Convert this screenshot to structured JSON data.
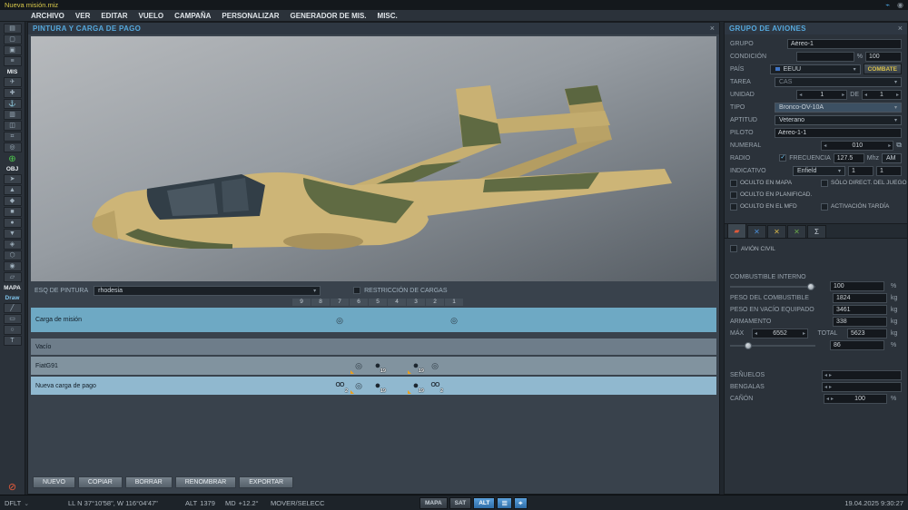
{
  "title_bar": {
    "title": "Nueva misión.miz"
  },
  "menu": {
    "items": [
      "ARCHIVO",
      "VER",
      "EDITAR",
      "VUELO",
      "CAMPAÑA",
      "PERSONALIZAR",
      "GENERADOR DE MIS.",
      "MISC."
    ]
  },
  "sidebar": {
    "items": [
      {
        "type": "icon",
        "name": "new-file",
        "glyph": "▤"
      },
      {
        "type": "icon",
        "name": "open-file",
        "glyph": "▢"
      },
      {
        "type": "icon",
        "name": "save-file",
        "glyph": "▣"
      },
      {
        "type": "icon",
        "name": "briefing",
        "glyph": "≡"
      },
      {
        "type": "label",
        "text": "MIS"
      },
      {
        "type": "icon",
        "name": "airplane-group",
        "glyph": "✈"
      },
      {
        "type": "icon",
        "name": "helicopter-group",
        "glyph": "✚"
      },
      {
        "type": "icon",
        "name": "ship-group",
        "glyph": "⚓"
      },
      {
        "type": "icon",
        "name": "vehicle-group",
        "glyph": "▥"
      },
      {
        "type": "icon",
        "name": "static-object",
        "glyph": "◫"
      },
      {
        "type": "icon",
        "name": "template",
        "glyph": "⌗"
      },
      {
        "type": "icon",
        "name": "trigger-zone",
        "glyph": "◎"
      },
      {
        "type": "icon",
        "name": "add-waypoint",
        "glyph": "⊕",
        "class": "green"
      },
      {
        "type": "label",
        "text": "OBJ"
      },
      {
        "type": "icon",
        "name": "objective-1",
        "glyph": "➤"
      },
      {
        "type": "icon",
        "name": "objective-2",
        "glyph": "▲"
      },
      {
        "type": "icon",
        "name": "objective-3",
        "glyph": "◆"
      },
      {
        "type": "icon",
        "name": "objective-4",
        "glyph": "■"
      },
      {
        "type": "icon",
        "name": "objective-5",
        "glyph": "●"
      },
      {
        "type": "icon",
        "name": "objective-6",
        "glyph": "▼"
      },
      {
        "type": "icon",
        "name": "objective-7",
        "glyph": "◈"
      },
      {
        "type": "icon",
        "name": "objective-8",
        "glyph": "⬡"
      },
      {
        "type": "icon",
        "name": "objective-9",
        "glyph": "◉"
      },
      {
        "type": "icon",
        "name": "objective-10",
        "glyph": "▱"
      },
      {
        "type": "label",
        "text": "MAPA"
      },
      {
        "type": "label",
        "text": "Draw",
        "class": "draw"
      },
      {
        "type": "icon",
        "name": "draw-line",
        "glyph": "╱"
      },
      {
        "type": "icon",
        "name": "draw-rect",
        "glyph": "▭"
      },
      {
        "type": "icon",
        "name": "draw-circle",
        "glyph": "○"
      },
      {
        "type": "icon",
        "name": "draw-text",
        "glyph": "T"
      },
      {
        "type": "icon",
        "name": "delete",
        "glyph": "⊘",
        "class": "red"
      }
    ]
  },
  "payload_panel": {
    "title": "PINTURA Y CARGA DE PAGO",
    "paint_label": "ESQ DE PINTURA",
    "paint_scheme": "rhodesia",
    "restriction_label": "RESTRICCIÓN DE CARGAS",
    "columns": [
      "9",
      "8",
      "7",
      "6",
      "5",
      "4",
      "3",
      "2",
      "1"
    ],
    "rows": [
      {
        "name": "Carga de misión",
        "style": "mission",
        "cells": {
          "7": {
            "kind": "pod",
            "glyph": "◎",
            "count": ""
          },
          "1": {
            "kind": "pod",
            "glyph": "◎",
            "count": ""
          }
        }
      },
      {
        "name": "Vacío",
        "style": "empty",
        "cells": {}
      },
      {
        "name": "FiatG91",
        "style": "normal",
        "cells": {
          "6": {
            "kind": "pod",
            "glyph": "◎",
            "count": "",
            "mark": true
          },
          "5": {
            "kind": "ball",
            "glyph": "●",
            "count": "19"
          },
          "3": {
            "kind": "ball",
            "glyph": "●",
            "count": "19",
            "mark": true
          },
          "2": {
            "kind": "pod",
            "glyph": "◎",
            "count": ""
          }
        }
      },
      {
        "name": "Nueva carga de pago",
        "style": "selected",
        "cells": {
          "7": {
            "kind": "twin",
            "glyph": "ΟΟ",
            "count": "2"
          },
          "6": {
            "kind": "pod",
            "glyph": "◎",
            "count": "",
            "mark": true
          },
          "5": {
            "kind": "ball",
            "glyph": "●",
            "count": "19"
          },
          "3": {
            "kind": "ball",
            "glyph": "●",
            "count": "19",
            "mark": true
          },
          "2": {
            "kind": "twin",
            "glyph": "ΟΟ",
            "count": "2"
          }
        }
      }
    ],
    "buttons": [
      "NUEVO",
      "COPIAR",
      "BORRAR",
      "RENOMBRAR",
      "EXPORTAR"
    ]
  },
  "group_panel": {
    "title": "GRUPO DE AVIONES",
    "fields": {
      "grupo": {
        "label": "GRUPO",
        "value": "Aéreo-1"
      },
      "condicion": {
        "label": "CONDICIÓN",
        "value": "",
        "value2": "100"
      },
      "pais": {
        "label": "PAÍS",
        "value": "EEUU",
        "combat": "COMBATE"
      },
      "tarea": {
        "label": "TAREA",
        "value": "CAS"
      },
      "unidad": {
        "label": "UNIDAD",
        "value": "1",
        "de": "DE",
        "value2": "1"
      },
      "tipo": {
        "label": "TIPO",
        "value": "Bronco-OV-10A"
      },
      "aptitud": {
        "label": "APTITUD",
        "value": "Veterano"
      },
      "piloto": {
        "label": "PILOTO",
        "value": "Aéreo-1-1"
      },
      "numeral": {
        "label": "NUMERAL",
        "value": "010"
      },
      "radio": {
        "label": "RADIO",
        "freq_label": "FRECUENCIA",
        "freq": "127.5",
        "unit": "Mhz",
        "mod": "AM"
      },
      "indicativo": {
        "label": "INDICATIVO",
        "value": "Enfield",
        "num1": "1",
        "num2": "1"
      }
    },
    "checkboxes": {
      "oculto_mapa": "OCULTO EN MAPA",
      "solo_direct": "SÓLO DIRECT. DEL JUEGO",
      "oculto_plan": "OCULTO EN PLANIFICAD.",
      "oculto_mfd": "OCULTO EN EL MFD",
      "activacion": "ACTIVACIÓN TARDÍA"
    },
    "tabs": [
      {
        "name": "tab-paint",
        "glyph": "▰",
        "color": "#e05a3a",
        "selected": true
      },
      {
        "name": "tab-payload",
        "glyph": "✕",
        "color": "#4a8fd8",
        "selected": false
      },
      {
        "name": "tab-flag-yellow",
        "glyph": "✕",
        "color": "#d8b84a",
        "selected": false
      },
      {
        "name": "tab-flag-green",
        "glyph": "✕",
        "color": "#6aa84a",
        "selected": false
      },
      {
        "name": "tab-summary",
        "glyph": "Σ",
        "color": "#c8d0d8",
        "selected": false
      }
    ],
    "avion_civil": "AVIÓN CIVIL",
    "fuel": {
      "internal_label": "COMBUSTIBLE INTERNO",
      "internal_value": "100",
      "fuel_weight_label": "PESO DEL COMBUSTIBLE",
      "fuel_weight": "1824",
      "empty_weight_label": "PESO EN VACÍO EQUIPADO",
      "empty_weight": "3461",
      "armament_label": "ARMAMENTO",
      "armament": "338",
      "max_label": "MÁX",
      "max": "6552",
      "total_label": "TOTAL",
      "total": "5623",
      "load_percent": "86"
    },
    "countermeasures": {
      "senuelos_label": "SEÑUELOS",
      "bengalas_label": "BENGALAS",
      "canon_label": "CAÑÓN",
      "canon_value": "100"
    }
  },
  "units": {
    "percent": "%",
    "kg": "kg"
  },
  "status_bar": {
    "preset": "DFLT",
    "coords": "LL   N 37°10'58\", W 116°04'47\"",
    "alt_label": "ALT",
    "alt": "1379",
    "md_label": "MD",
    "md": "+12.2°",
    "mode": "MOVER/SELECC",
    "buttons": {
      "mapa": "MAPA",
      "sat": "SAT",
      "alt": "ALT"
    },
    "datetime": "19.04.2025 9:30:27"
  },
  "icons": {
    "close": "×",
    "dropdown": "▾",
    "spin_left": "◂",
    "spin_right": "▸",
    "check": "✓",
    "copy": "⧉",
    "wifi": "⌁",
    "connection": "◉",
    "caret_down": "⌄",
    "layers": "≣",
    "target": "⌖"
  }
}
